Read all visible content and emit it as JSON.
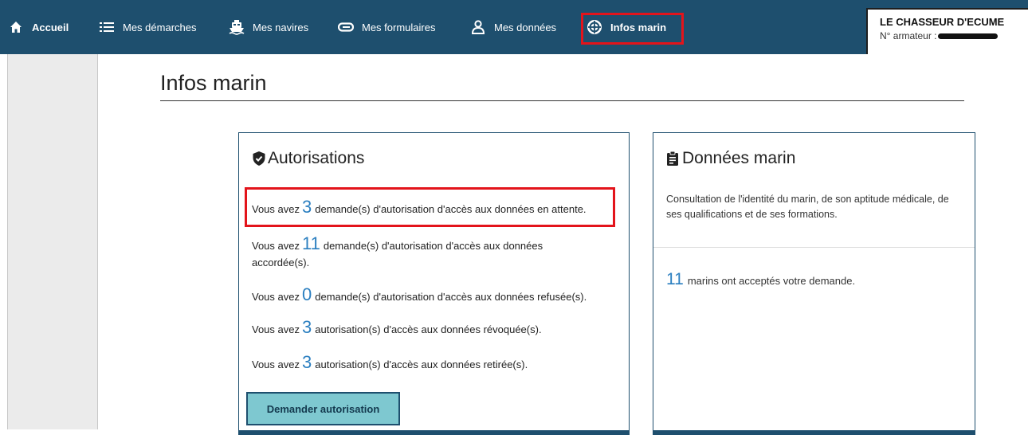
{
  "nav": {
    "items": [
      {
        "label": "Accueil",
        "icon": "home-icon"
      },
      {
        "label": "Mes démarches",
        "icon": "list-icon"
      },
      {
        "label": "Mes navires",
        "icon": "ship-icon"
      },
      {
        "label": "Mes formulaires",
        "icon": "link-icon"
      },
      {
        "label": "Mes données",
        "icon": "user-icon"
      },
      {
        "label": "Infos marin",
        "icon": "steering-wheel-icon"
      }
    ],
    "active": "Infos marin"
  },
  "owner": {
    "name": "LE CHASSEUR D'ECUME",
    "armateur_label": "N° armateur :"
  },
  "page_title": "Infos marin",
  "autorisations": {
    "title": "Autorisations",
    "icon": "shield-check-icon",
    "lines": [
      {
        "prefix": "Vous avez",
        "count": "3",
        "suffix": "demande(s) d'autorisation d'accès aux données en attente."
      },
      {
        "prefix": "Vous avez",
        "count": "11",
        "suffix": "demande(s) d'autorisation d'accès aux données accordée(s)."
      },
      {
        "prefix": "Vous avez",
        "count": "0",
        "suffix": "demande(s) d'autorisation d'accès aux données refusée(s)."
      },
      {
        "prefix": "Vous avez",
        "count": "3",
        "suffix": "autorisation(s) d'accès aux données révoquée(s)."
      },
      {
        "prefix": "Vous avez",
        "count": "3",
        "suffix": "autorisation(s) d'accès aux données retirée(s)."
      }
    ],
    "button_label": "Demander autorisation"
  },
  "donnees": {
    "title": "Données marin",
    "icon": "clipboard-icon",
    "description": "Consultation de l'identité du marin, de son aptitude médicale, de ses qualifications et de ses formations.",
    "accepted_count": "11",
    "accepted_text": "marins ont acceptés votre demande."
  },
  "colors": {
    "navbar": "#1e4f6e",
    "highlight": "#e3141b",
    "count": "#2b7fc0",
    "button": "#7ec8d0"
  }
}
